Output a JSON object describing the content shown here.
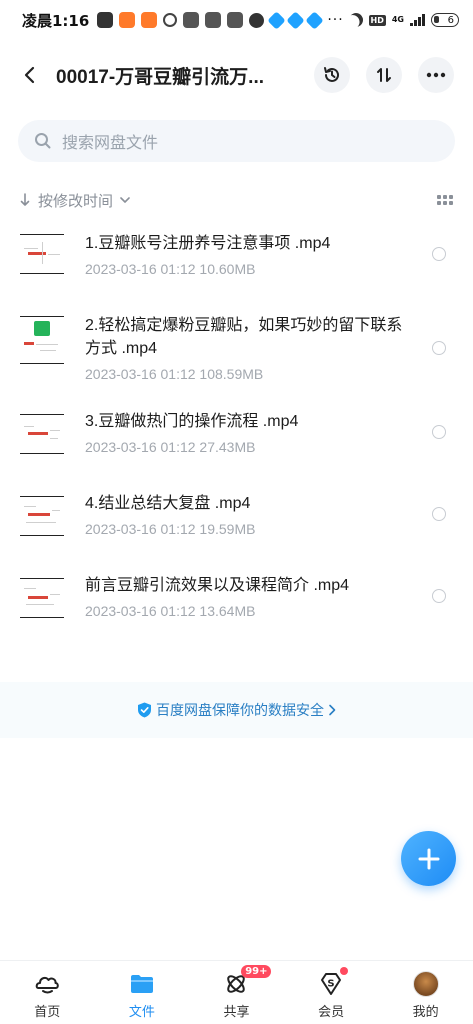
{
  "status_bar": {
    "time": "凌晨1:16",
    "network": "4G",
    "hd": "HD",
    "battery": "6"
  },
  "header": {
    "title": "00017-万哥豆瓣引流万..."
  },
  "search": {
    "placeholder": "搜索网盘文件"
  },
  "sort": {
    "label": "按修改时间"
  },
  "files": [
    {
      "name": "1.豆瓣账号注册养号注意事项 .mp4",
      "meta": "2023-03-16  01:12  10.60MB"
    },
    {
      "name": "2.轻松搞定爆粉豆瓣贴，如果巧妙的留下联系方式 .mp4",
      "meta": "2023-03-16  01:12  108.59MB"
    },
    {
      "name": "3.豆瓣做热门的操作流程 .mp4",
      "meta": "2023-03-16  01:12  27.43MB"
    },
    {
      "name": "4.结业总结大复盘 .mp4",
      "meta": "2023-03-16  01:12  19.59MB"
    },
    {
      "name": "前言豆瓣引流效果以及课程简介 .mp4",
      "meta": "2023-03-16  01:12  13.64MB"
    }
  ],
  "security_banner": {
    "text": "百度网盘保障你的数据安全"
  },
  "nav": {
    "items": [
      {
        "label": "首页"
      },
      {
        "label": "文件"
      },
      {
        "label": "共享",
        "badge": "99+"
      },
      {
        "label": "会员"
      },
      {
        "label": "我的"
      }
    ]
  },
  "colors": {
    "accent": "#1f8ef1",
    "badge": "#ff4a5f"
  }
}
